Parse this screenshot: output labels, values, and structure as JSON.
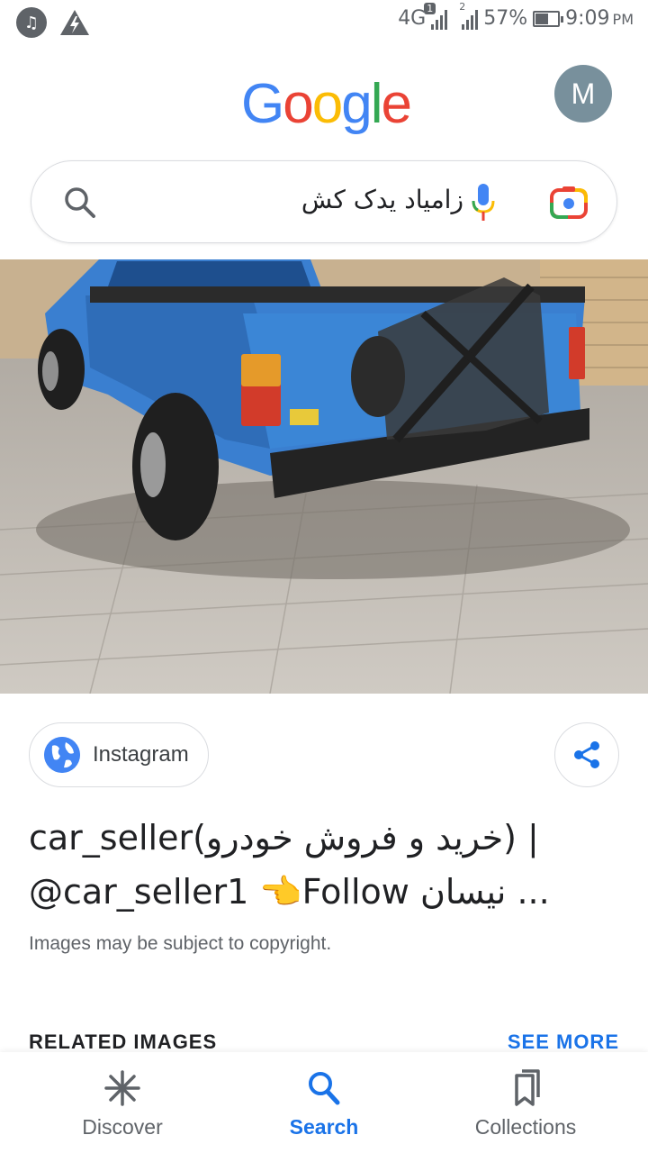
{
  "status_bar": {
    "network": "4G",
    "sim1_badge": "1",
    "sim2_badge": "2",
    "battery_percent": "57%",
    "battery_level": 0.57,
    "time": "9:09",
    "time_suffix": "PM",
    "left_icons": [
      "music-icon",
      "flash-icon"
    ]
  },
  "header": {
    "logo_letters": [
      {
        "char": "G",
        "color": "#4285F4"
      },
      {
        "char": "o",
        "color": "#EA4335"
      },
      {
        "char": "o",
        "color": "#FBBC05"
      },
      {
        "char": "g",
        "color": "#4285F4"
      },
      {
        "char": "l",
        "color": "#34A853"
      },
      {
        "char": "e",
        "color": "#EA4335"
      }
    ],
    "avatar_initial": "M",
    "avatar_color": "#78909C"
  },
  "search": {
    "query": "زامیاد یدک کش",
    "icons": [
      "search-icon",
      "mic-icon",
      "lens-icon"
    ]
  },
  "result": {
    "source": "Instagram",
    "title_line1": "car_seller(خرید و فروش خودرو) |",
    "title_line2": "@car_seller1 👈Follow نیسان ...",
    "copyright": "Images may be subject to copyright."
  },
  "related": {
    "heading": "RELATED IMAGES",
    "see_more": "SEE MORE"
  },
  "bottom_nav": {
    "items": [
      {
        "label": "Discover",
        "icon": "asterisk-icon",
        "active": false
      },
      {
        "label": "Search",
        "icon": "search-icon",
        "active": true
      },
      {
        "label": "Collections",
        "icon": "bookmarks-icon",
        "active": false
      }
    ]
  },
  "colors": {
    "accent": "#1A73E8",
    "truck_blue": "#3A7FD0"
  }
}
